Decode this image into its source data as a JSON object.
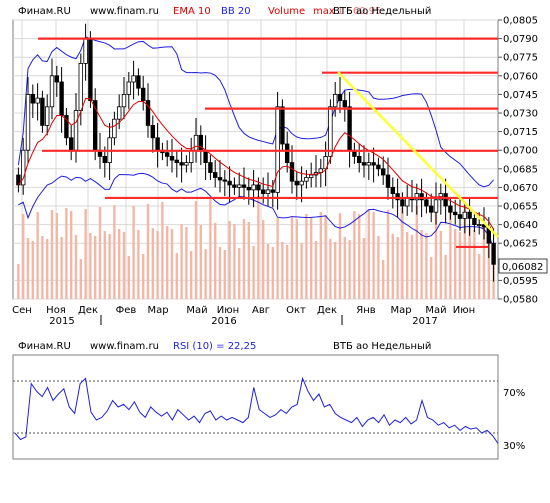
{
  "chart_data": [
    {
      "type": "candlestick",
      "header": {
        "source": "Финам.RU",
        "site": "www.finam.ru",
        "indicators": [
          "EMA 10",
          "BB 20",
          "Volume"
        ],
        "indicator_colors": [
          "#e00000",
          "#1f1fe0",
          "#e00000"
        ],
        "max_label": "max",
        "max_value": "1 560,95...",
        "title": "ВТБ ао Недельный"
      },
      "x_months": [
        "Сен",
        "Ноя",
        "Дек",
        "Фев",
        "Мар",
        "Май",
        "Июн",
        "Авг",
        "Окт",
        "Дек",
        "Янв",
        "Мар",
        "Май",
        "Июн"
      ],
      "x_years": [
        "2015",
        "2016",
        "2017"
      ],
      "y_ticks": [
        "0,0805",
        "0,0790",
        "0,0775",
        "0,0760",
        "0,0745",
        "0,0730",
        "0,0715",
        "0,0700",
        "0,0685",
        "0,0670",
        "0,0655",
        "0,0640",
        "0,0625",
        "0,0595",
        "0,0580"
      ],
      "ylim": [
        0.058,
        0.0805
      ],
      "last_price": "0,06082",
      "closes": [
        0.0672,
        0.07,
        0.0745,
        0.0738,
        0.0742,
        0.072,
        0.0735,
        0.076,
        0.0755,
        0.0728,
        0.071,
        0.07,
        0.0732,
        0.077,
        0.079,
        0.074,
        0.07,
        0.0695,
        0.069,
        0.071,
        0.0725,
        0.0735,
        0.0745,
        0.0755,
        0.076,
        0.075,
        0.074,
        0.072,
        0.071,
        0.07,
        0.0698,
        0.0695,
        0.0692,
        0.069,
        0.0688,
        0.069,
        0.07,
        0.0712,
        0.07,
        0.069,
        0.0682,
        0.0678,
        0.0676,
        0.0675,
        0.0672,
        0.067,
        0.0672,
        0.067,
        0.0668,
        0.0672,
        0.0668,
        0.0665,
        0.0668,
        0.0666,
        0.0735,
        0.0705,
        0.069,
        0.0675,
        0.0672,
        0.0675,
        0.0678,
        0.068,
        0.0682,
        0.0685,
        0.0695,
        0.0735,
        0.0745,
        0.074,
        0.0735,
        0.07,
        0.0695,
        0.069,
        0.0688,
        0.069,
        0.0688,
        0.0685,
        0.068,
        0.067,
        0.0665,
        0.066,
        0.0655,
        0.0662,
        0.066,
        0.0665,
        0.066,
        0.0655,
        0.065,
        0.066,
        0.0665,
        0.0655,
        0.065,
        0.0648,
        0.0645,
        0.065,
        0.0645,
        0.064,
        0.064,
        0.0638,
        0.0625,
        0.0608
      ],
      "levels": [
        {
          "name": "resistance-0790",
          "value": 0.079
        },
        {
          "name": "resistance-0760",
          "value": 0.07625
        },
        {
          "name": "resistance-0733",
          "value": 0.07335
        },
        {
          "name": "resistance-0700",
          "value": 0.06995
        },
        {
          "name": "support-0662",
          "value": 0.06615
        },
        {
          "name": "support-0622",
          "value": 0.0622
        }
      ],
      "trendline": {
        "from": {
          "x": 0.0,
          "y": 0.0763
        },
        "to": {
          "x": 1.0,
          "y": 0.063
        }
      }
    },
    {
      "type": "line",
      "header": {
        "source": "Финам.RU",
        "site": "www.finam.ru",
        "rsi_label": "RSI (10) = 22,25",
        "title": "ВТБ ао Недельный"
      },
      "level_labels": [
        "70%",
        "30%"
      ],
      "levels": [
        70,
        30
      ],
      "ylim": [
        10,
        90
      ],
      "rsi": [
        30,
        25,
        27,
        68,
        62,
        58,
        65,
        55,
        60,
        64,
        50,
        45,
        68,
        72,
        46,
        40,
        42,
        47,
        55,
        50,
        52,
        48,
        54,
        46,
        42,
        50,
        46,
        43,
        46,
        40,
        48,
        44,
        40,
        43,
        38,
        45,
        47,
        40,
        43,
        40,
        42,
        40,
        38,
        42,
        65,
        48,
        45,
        42,
        44,
        48,
        45,
        50,
        52,
        72,
        62,
        55,
        60,
        50,
        52,
        45,
        42,
        40,
        38,
        42,
        35,
        40,
        42,
        38,
        44,
        36,
        40,
        38,
        42,
        37,
        40,
        55,
        42,
        40,
        36,
        38,
        34,
        36,
        32,
        35,
        33,
        34,
        30,
        32,
        28,
        22
      ]
    }
  ]
}
